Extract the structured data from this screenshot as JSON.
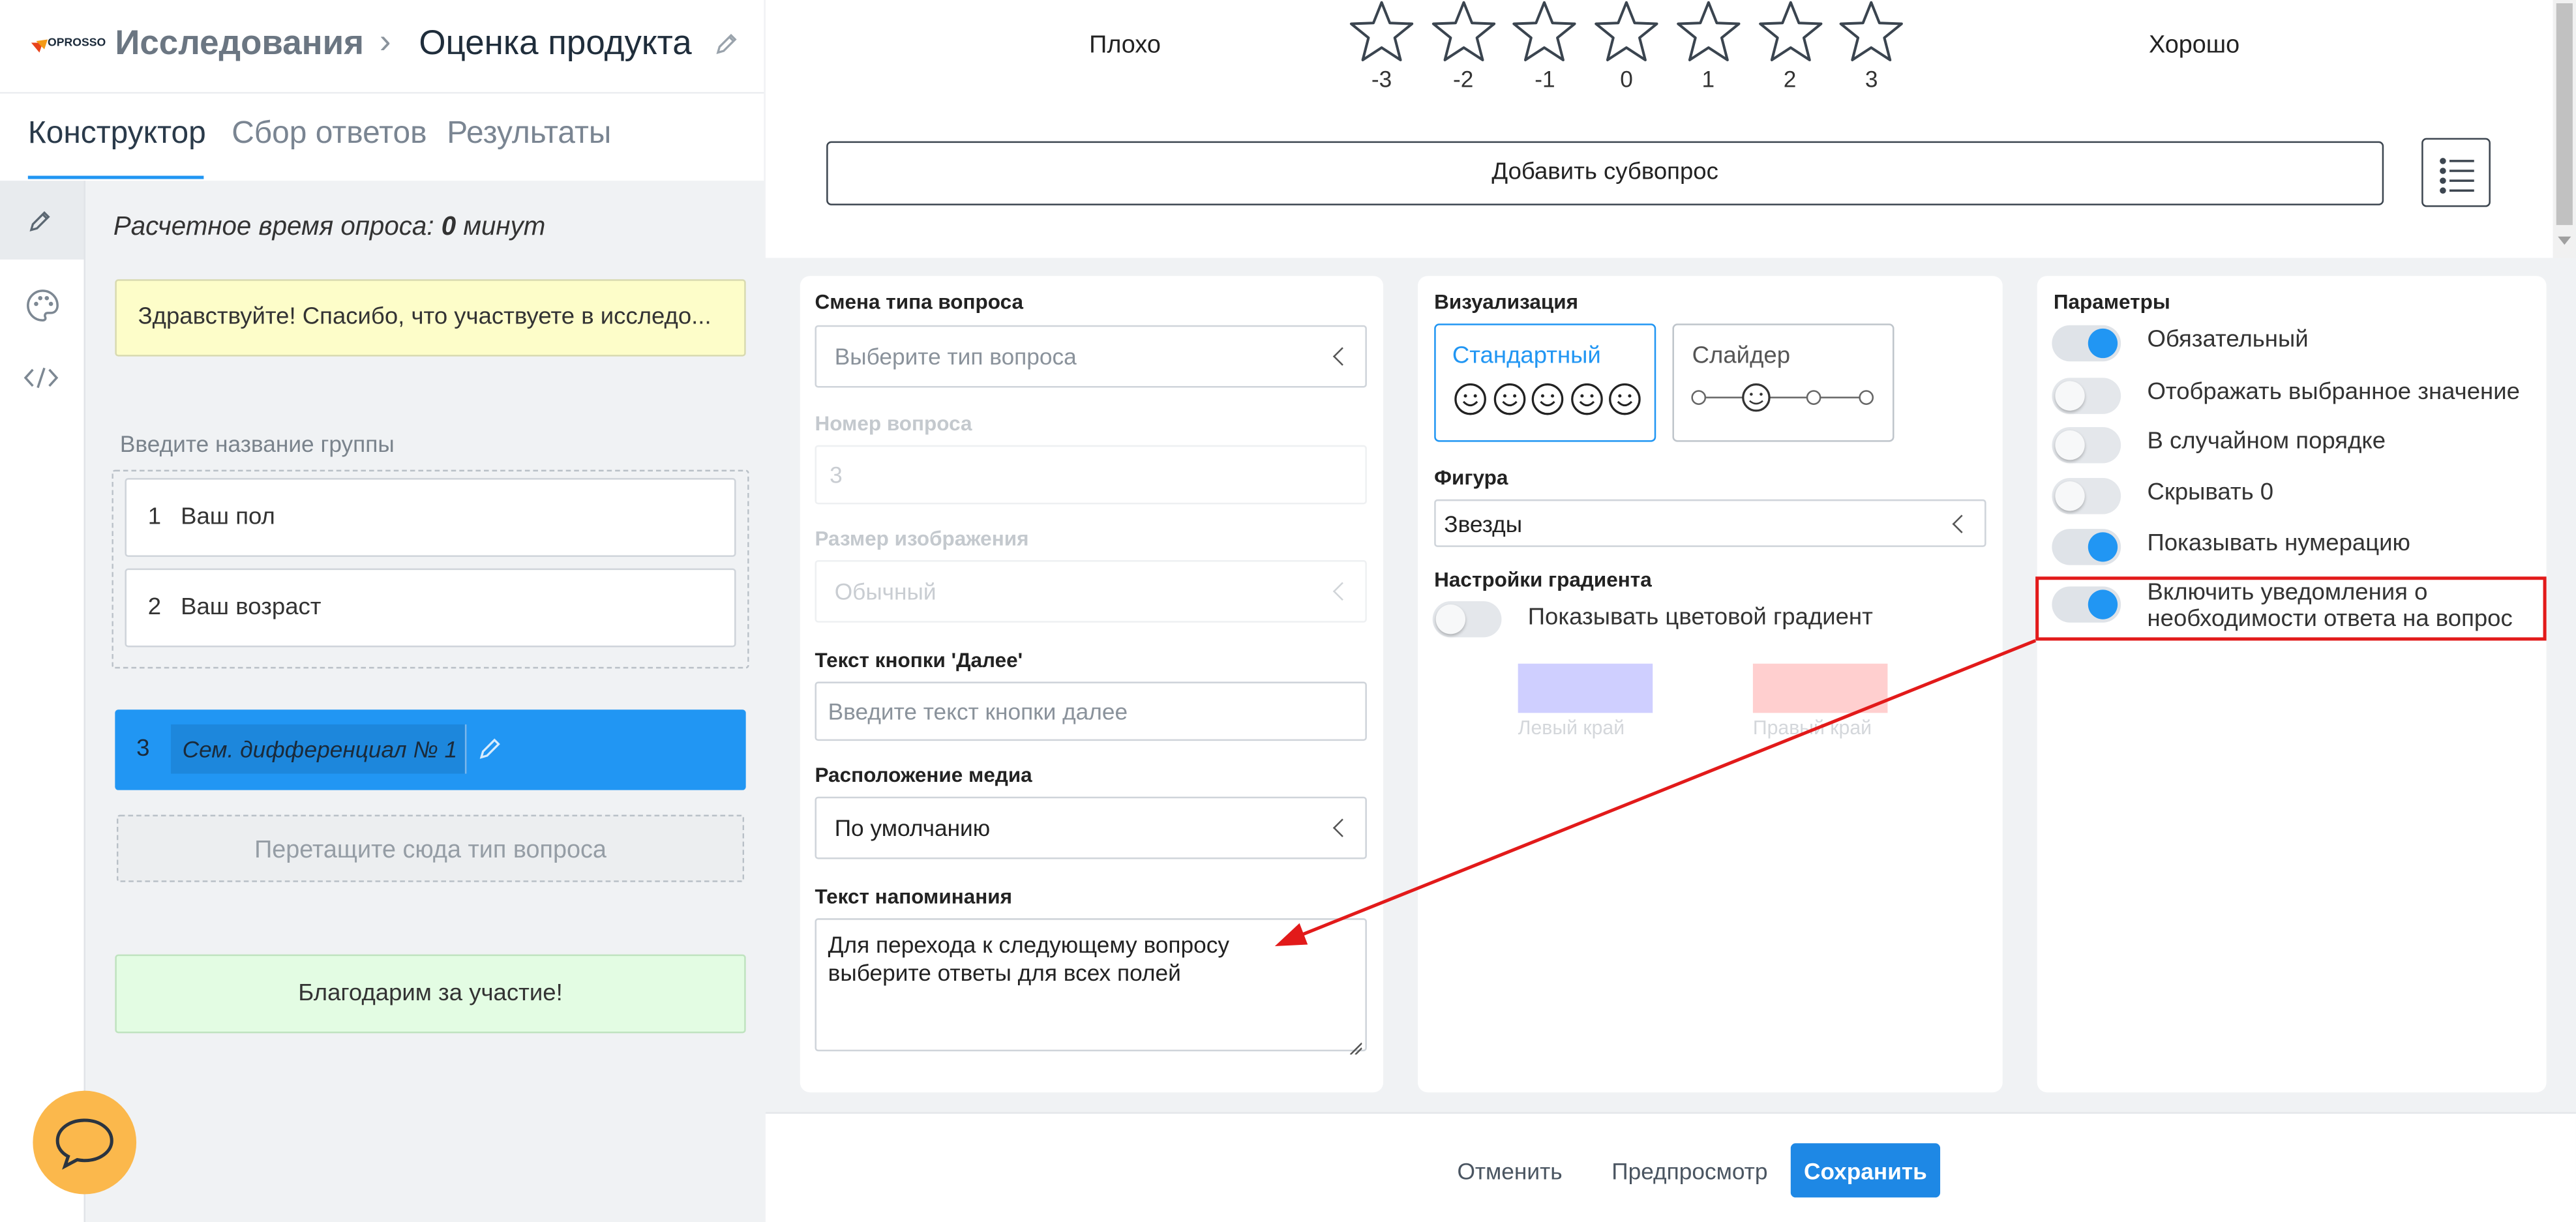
{
  "colors": {
    "accent": "#2196f3",
    "save_button": "#1e88e5",
    "welcome_bg": "#fdfdc9",
    "thanks_bg": "#e3fce3",
    "chat_button": "#fbb84c",
    "annotation": "#e21a1a"
  },
  "header": {
    "logo_text": "OPROSSO",
    "breadcrumb_parent": "Исследования",
    "breadcrumb_sep": "›",
    "breadcrumb_current": "Оценка продукта"
  },
  "tabs": [
    "Конструктор",
    "Сбор ответов",
    "Результаты"
  ],
  "sidebar": {
    "estimated_time": {
      "prefix": "Расчетное время опроса:",
      "value": "0",
      "suffix": "минут"
    },
    "welcome_text": "Здравствуйте! Спасибо, что участвуете в исследо...",
    "group_name_placeholder": "Введите название группы",
    "questions": [
      {
        "num": "1",
        "title": "Ваш пол"
      },
      {
        "num": "2",
        "title": "Ваш возраст"
      }
    ],
    "active_question": {
      "num": "3",
      "title": "Сем. дифференциал № 1"
    },
    "drop_zone": "Перетащите сюда тип вопроса",
    "thanks_text": "Благодарим за участие!"
  },
  "scale": {
    "left_label": "Плохо",
    "right_label": "Хорошо",
    "values": [
      "-3",
      "-2",
      "-1",
      "0",
      "1",
      "2",
      "3"
    ]
  },
  "add_subquestion": "Добавить субвопрос",
  "col1": {
    "change_type_label": "Смена типа вопроса",
    "change_type_placeholder": "Выберите тип вопроса",
    "question_number_label": "Номер вопроса",
    "question_number_value": "3",
    "image_size_label": "Размер изображения",
    "image_size_value": "Обычный",
    "next_text_label": "Текст кнопки 'Далее'",
    "next_text_placeholder": "Введите текст кнопки далее",
    "media_label": "Расположение медиа",
    "media_value": "По умолчанию",
    "reminder_label": "Текст напоминания",
    "reminder_value": "Для перехода к следующему вопросу\nвыберите ответы для всех полей"
  },
  "col2": {
    "visual_label": "Визуализация",
    "standard": "Стандартный",
    "slider": "Слайдер",
    "figure_label": "Фигура",
    "figure_value": "Звезды",
    "gradient_label": "Настройки градиента",
    "gradient_toggle": "Показывать цветовой градиент",
    "left_edge": "Левый край",
    "right_edge": "Правый край",
    "left_color": "#cfcfff",
    "right_color": "#ffcfcf"
  },
  "params": {
    "title": "Параметры",
    "items": [
      {
        "label": "Обязательный",
        "on": true
      },
      {
        "label": "Отображать выбранное значение",
        "on": false
      },
      {
        "label": "В случайном порядке",
        "on": false
      },
      {
        "label": "Скрывать 0",
        "on": false
      },
      {
        "label": "Показывать нумерацию",
        "on": true
      },
      {
        "label": "Включить уведомления о\nнеобходимости ответа на вопрос",
        "on": true
      }
    ]
  },
  "footer": {
    "cancel": "Отменить",
    "preview": "Предпросмотр",
    "save": "Сохранить"
  }
}
